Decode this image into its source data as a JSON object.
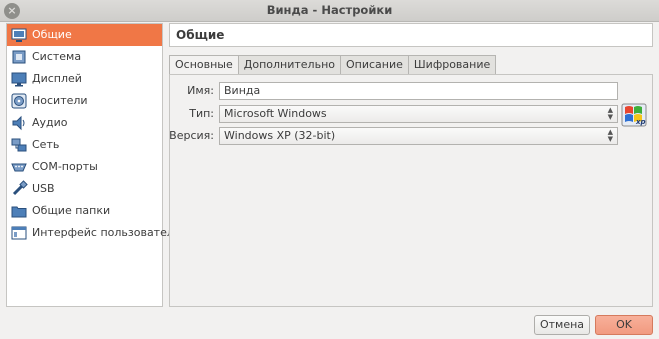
{
  "window": {
    "title": "Винда - Настройки",
    "close_glyph": "×"
  },
  "sidebar": {
    "items": [
      {
        "label": "Общие",
        "icon": "general-icon",
        "selected": true
      },
      {
        "label": "Система",
        "icon": "system-icon"
      },
      {
        "label": "Дисплей",
        "icon": "display-icon"
      },
      {
        "label": "Носители",
        "icon": "storage-icon"
      },
      {
        "label": "Аудио",
        "icon": "audio-icon"
      },
      {
        "label": "Сеть",
        "icon": "network-icon"
      },
      {
        "label": "COM-порты",
        "icon": "serial-ports-icon"
      },
      {
        "label": "USB",
        "icon": "usb-icon"
      },
      {
        "label": "Общие папки",
        "icon": "shared-folders-icon"
      },
      {
        "label": "Интерфейс пользователя",
        "icon": "user-interface-icon"
      }
    ]
  },
  "page": {
    "title": "Общие",
    "tabs": [
      {
        "label": "Основные",
        "active": true
      },
      {
        "label": "Дополнительно"
      },
      {
        "label": "Описание"
      },
      {
        "label": "Шифрование"
      }
    ],
    "fields": {
      "name": {
        "label": "Имя:",
        "value": "Винда"
      },
      "type": {
        "label": "Тип:",
        "value": "Microsoft Windows"
      },
      "version": {
        "label": "Версия:",
        "value": "Windows XP (32-bit)"
      }
    },
    "os_icon": {
      "name": "windows-xp-icon",
      "badge": "xp"
    }
  },
  "buttons": {
    "cancel": "Отмена",
    "ok": "OK"
  },
  "colors": {
    "accent": "#f07746",
    "ok_button": "#f19a80"
  }
}
